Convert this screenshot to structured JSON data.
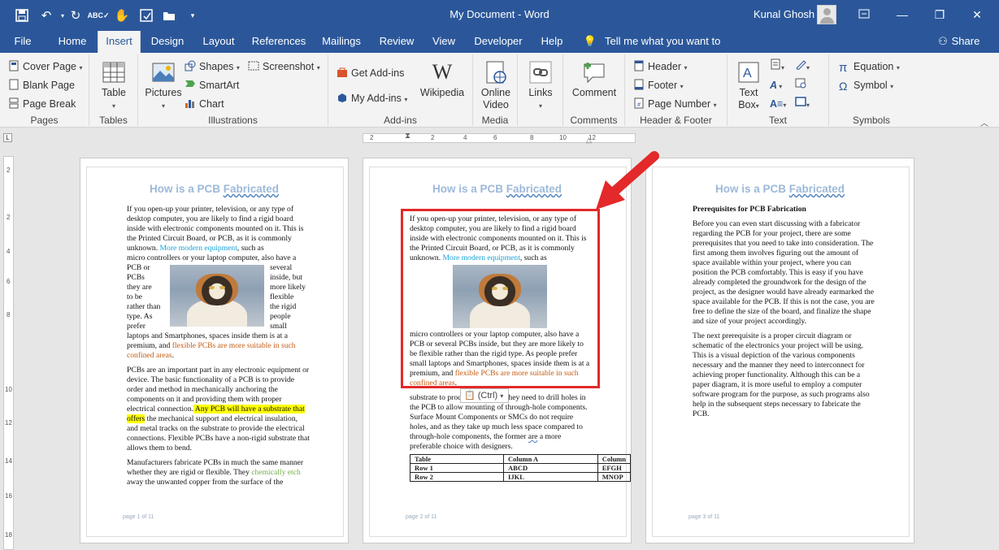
{
  "app": {
    "title": "My Document  -  Word",
    "user": "Kunal Ghosh"
  },
  "tabs": [
    "File",
    "Home",
    "Insert",
    "Design",
    "Layout",
    "References",
    "Mailings",
    "Review",
    "View",
    "Developer",
    "Help"
  ],
  "active_tab": "Insert",
  "tell_me": "Tell me what you want to do",
  "share": "Share",
  "ribbon": {
    "pages": {
      "label": "Pages",
      "cover": "Cover Page",
      "blank": "Blank Page",
      "break": "Page Break"
    },
    "tables": {
      "label": "Tables",
      "table": "Table"
    },
    "illustrations": {
      "label": "Illustrations",
      "pictures": "Pictures",
      "shapes": "Shapes",
      "smartart": "SmartArt",
      "chart": "Chart",
      "screenshot": "Screenshot"
    },
    "addins": {
      "label": "Add-ins",
      "get": "Get Add-ins",
      "my": "My Add-ins",
      "wiki": "Wikipedia"
    },
    "media": {
      "label": "Media",
      "video1": "Online",
      "video2": "Video"
    },
    "links": {
      "label": "",
      "links": "Links"
    },
    "comments": {
      "label": "Comments",
      "comment": "Comment"
    },
    "header_footer": {
      "label": "Header & Footer",
      "header": "Header",
      "footer": "Footer",
      "page_number": "Page Number"
    },
    "text": {
      "label": "Text",
      "textbox1": "Text",
      "textbox2": "Box"
    },
    "symbols": {
      "label": "Symbols",
      "equation": "Equation",
      "symbol": "Symbol"
    }
  },
  "ruler": {
    "h": [
      "2",
      "2",
      "4",
      "6",
      "8",
      "10",
      "12"
    ],
    "v": [
      "2",
      "2",
      "4",
      "6",
      "8",
      "10",
      "12",
      "14",
      "16",
      "18"
    ]
  },
  "doc": {
    "title_a": "How is a PCB ",
    "title_b": "Fabricated",
    "p1": {
      "intro": "If you open-up your printer, television, or any type of desktop computer, you are likely to find a rigid board inside with electronic components mounted on it. This is the Printed Circuit Board, or PCB, as it is commonly unknown. ",
      "link": "More modern equipment",
      "after": ", such as",
      "micro": "micro controllers or your laptop computer, also have a",
      "left": [
        "PCB or",
        "PCBs",
        "they are",
        "to be",
        "rather than",
        "type. As",
        "prefer"
      ],
      "right": [
        "several",
        "inside, but",
        "more likely",
        "flexible",
        "the rigid",
        "people",
        "small"
      ],
      "tail": "laptops and Smartphones, spaces inside them is at a premium, and ",
      "flex": "flexible PCBs are more suitable in such confined areas",
      "end": ".",
      "para2a": "PCBs are an important part in any electronic equipment or device. The basic functionality of a PCB is to provide order and method in mechanically anchoring the components on it and providing them with proper electrical connection.",
      "para2hl": " Any PCB will have a substrate that offers",
      "para2b": " the mechanical support and electrical insulation, and metal tracks on the substrate to provide the electrical connections. Flexible PCBs have a non-rigid substrate that allows them to bend.",
      "para3a": "Manufacturers fabricate PCBs in much the same manner whether they are rigid or flexible. They ",
      "etch": "chemically etch",
      "para3b": " away the unwanted copper from the surface of the",
      "footer": "page 1 of 11"
    },
    "p2": {
      "box_tail": "micro controllers or your laptop computer, also have a PCB or several PCBs inside, but they are more likely to be flexible rather than the rigid type. As people prefer small laptops and Smartphones, spaces inside them is at a premium, and ",
      "sub1": "substrate to proc",
      "sub2": "hey need to drill holes in",
      "sub3": "the PCB to allow mounting of through-hole components. Surface Mount Components or SMCs do not require holes, and as they take up much less space compared to through-hole components, the former ",
      "are": "are",
      "sub4": " a more preferable choice with designers.",
      "table": [
        [
          "Table",
          "Column A",
          "Column"
        ],
        [
          "Row 1",
          "ABCD",
          "EFGH"
        ],
        [
          "Row 2",
          "IJKL",
          "MNOP"
        ]
      ],
      "ctrl": "(Ctrl)",
      "footer": "page 2 of 11"
    },
    "p3": {
      "heading": "Prerequisites for PCB Fabrication",
      "para1": "Before you can even start discussing with a fabricator regarding the PCB for your project, there are some prerequisites that you need to take into consideration. The first among them involves figuring out the amount of space available within your project, where you can position the PCB comfortably. This is easy if you have already completed the groundwork for the design of the project, as the designer would have already earmarked the space available for the PCB. If this is not the case, you are free to define the size of the board, and finalize the shape and size of your project accordingly.",
      "para2": "The next prerequisite is a proper circuit diagram or schematic of the electronics your project will be using. This is a visual depiction of the various components necessary and the manner they need to interconnect for achieving proper functionality. Although this can be a paper diagram, it is more useful to employ a computer software program for the purpose, as such programs also help in the subsequent steps necessary to fabricate the PCB.",
      "footer": "page 3 of 11"
    }
  },
  "colors": {
    "brand": "#2b579a",
    "highlight": "#ffff00",
    "callout": "#e32929"
  }
}
